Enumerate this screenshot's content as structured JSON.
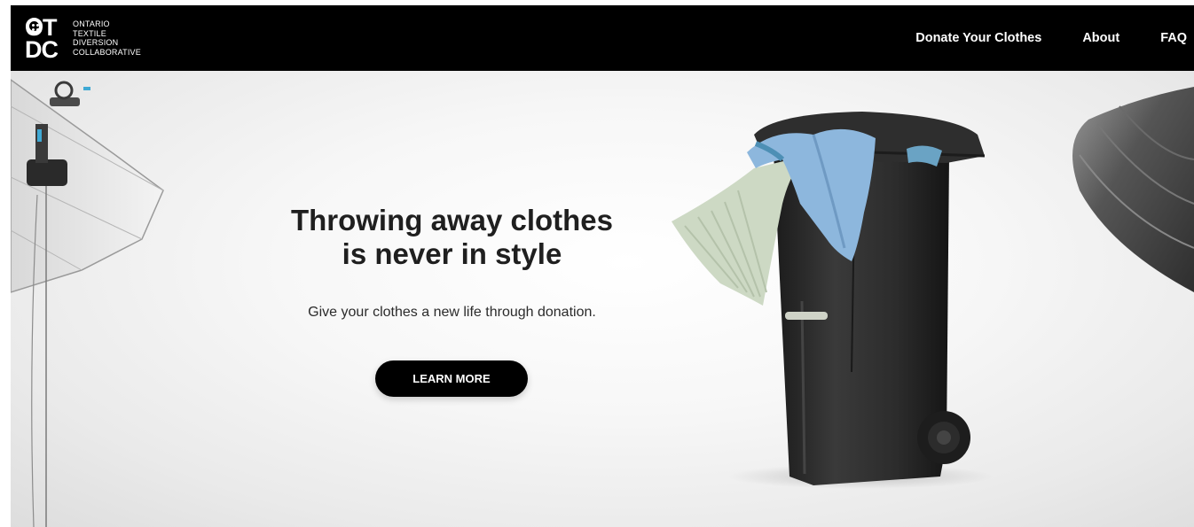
{
  "logo": {
    "mark_line1": "OT",
    "mark_line2": "DC",
    "text_lines": [
      "ONTARIO",
      "TEXTILE",
      "DIVERSION",
      "COLLABORATIVE"
    ]
  },
  "nav": {
    "items": [
      {
        "label": "Donate Your Clothes"
      },
      {
        "label": "About"
      },
      {
        "label": "FAQ"
      }
    ]
  },
  "hero": {
    "title_line1": "Throwing away clothes",
    "title_line2": "is never in style",
    "subtitle": "Give your clothes a new life through donation.",
    "cta_label": "LEARN MORE"
  },
  "colors": {
    "header_bg": "#000000",
    "cta_bg": "#000000",
    "text": "#1f1f1f",
    "bin": "#2a2a2a"
  }
}
